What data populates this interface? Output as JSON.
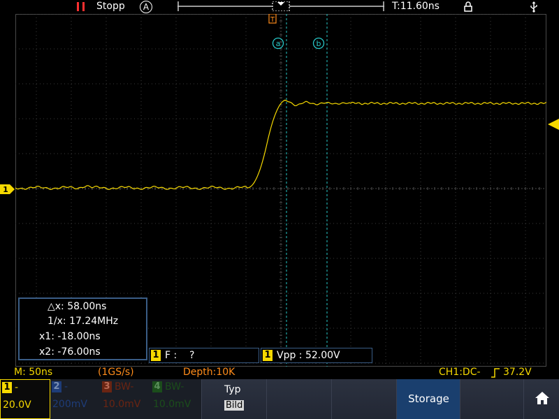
{
  "status": {
    "run_state": "Stopp",
    "mode": "A",
    "trigger_time": "T:11.60ns"
  },
  "cursors": {
    "marker_a": "a",
    "marker_b": "b",
    "trigger_marker": "T",
    "delta_x": "△x: 58.00ns",
    "inv_x": "1/x: 17.24MHz",
    "x1": "x1: -18.00ns",
    "x2": "x2: -76.00ns"
  },
  "channel_marker": "1",
  "measurements": [
    {
      "channel": "1",
      "text": "F :    ?"
    },
    {
      "channel": "1",
      "text": "Vpp : 52.00V"
    }
  ],
  "info": {
    "timebase": "M: 50ns",
    "sample_rate": "(1GS/s)",
    "depth": "Depth:10K",
    "trigger": "CH1:DC-",
    "trigger_level": "37.2V"
  },
  "channels": [
    {
      "num": "1",
      "label": "-",
      "value": "20.0V",
      "color": "#f5d800",
      "active": true
    },
    {
      "num": "2",
      "label": "-",
      "value": "200mV",
      "color": "#1e3c78",
      "active": false
    },
    {
      "num": "3",
      "label": "BW-",
      "value": "10.0mV",
      "color": "#6a2412",
      "active": false
    },
    {
      "num": "4",
      "label": "BW-",
      "value": "10.0mV",
      "color": "#1b4d1b",
      "active": false
    }
  ],
  "menu": {
    "typ_label": "Typ",
    "typ_value": "Bild",
    "storage_label": "Storage"
  },
  "colors": {
    "waveform": "#f5d800",
    "cursor": "#28c8c8",
    "measure_border": "#3a5d86",
    "highlight": "#1a3f6e"
  }
}
